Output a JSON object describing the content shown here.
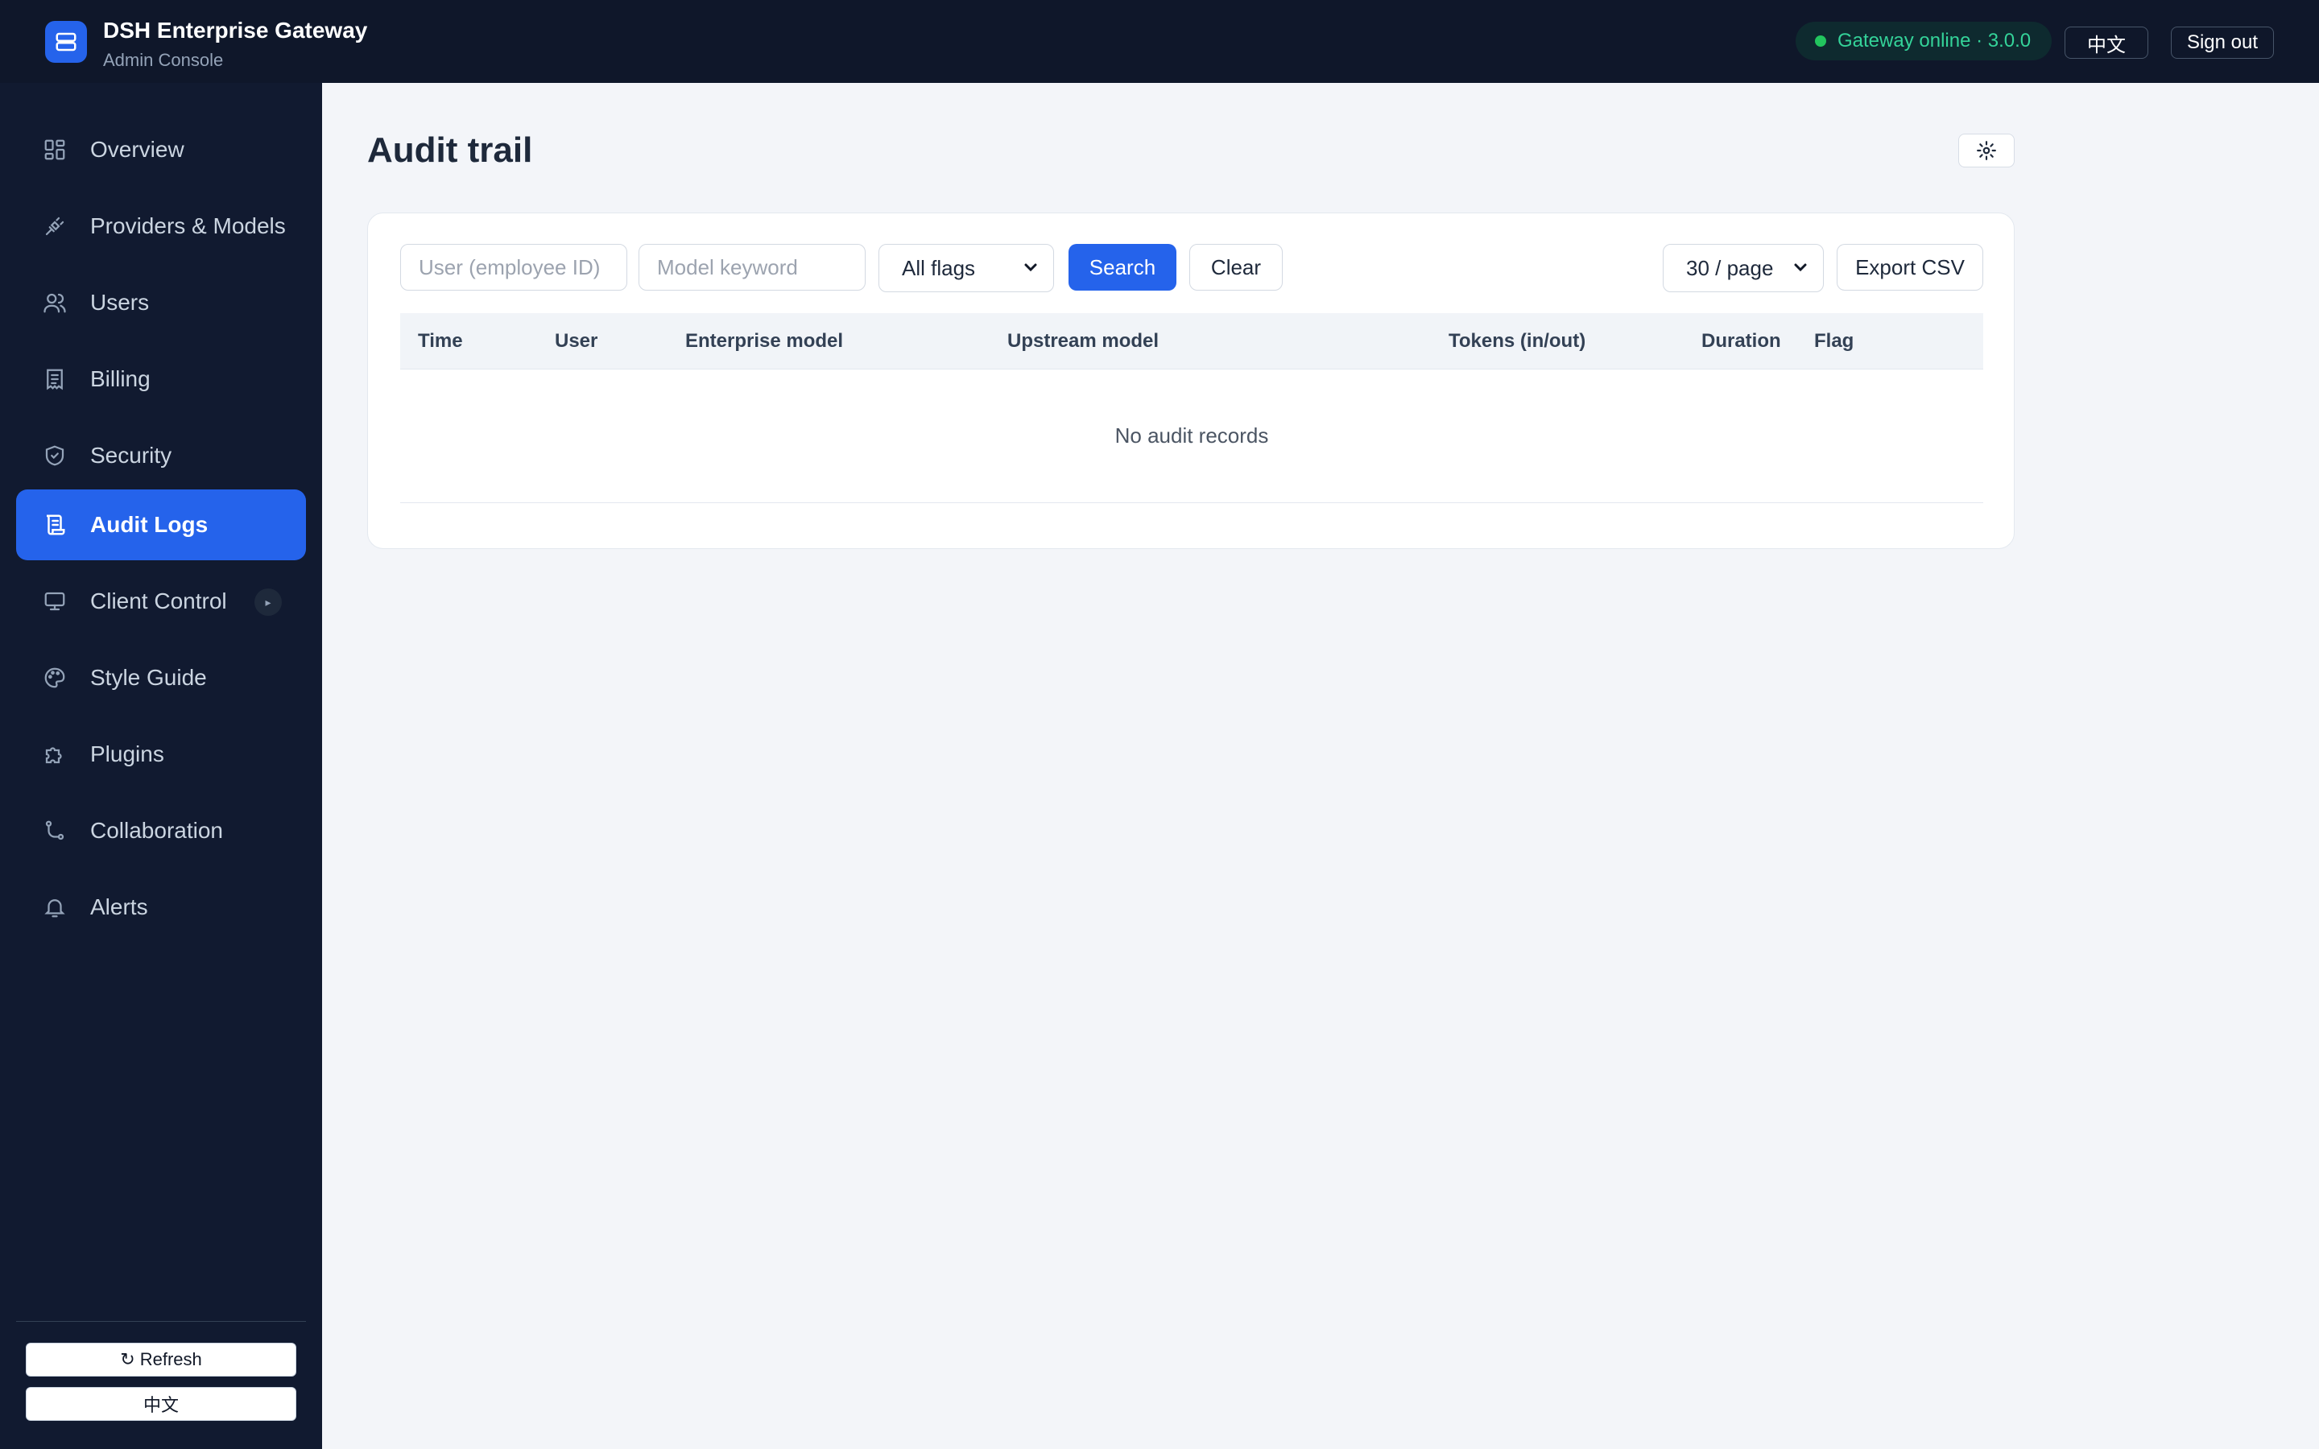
{
  "header": {
    "title": "DSH Enterprise Gateway",
    "subtitle": "Admin Console",
    "status": "Gateway online · 3.0.0",
    "status_color": "#34d399",
    "lang_button": "中文",
    "signout_button": "Sign out"
  },
  "sidebar": {
    "items": [
      {
        "label": "Overview",
        "icon": "grid-icon"
      },
      {
        "label": "Providers & Models",
        "icon": "plug-icon"
      },
      {
        "label": "Users",
        "icon": "users-icon"
      },
      {
        "label": "Billing",
        "icon": "receipt-icon"
      },
      {
        "label": "Security",
        "icon": "shield-icon"
      },
      {
        "label": "Audit Logs",
        "icon": "scroll-icon",
        "active": true
      },
      {
        "label": "Client Control",
        "icon": "monitor-icon",
        "badge": "▸"
      },
      {
        "label": "Style Guide",
        "icon": "palette-icon"
      },
      {
        "label": "Plugins",
        "icon": "puzzle-icon"
      },
      {
        "label": "Collaboration",
        "icon": "git-branch-icon"
      },
      {
        "label": "Alerts",
        "icon": "bell-icon"
      }
    ],
    "refresh_button": "↻ Refresh",
    "lang_button": "中文",
    "accent": "#2563eb"
  },
  "main": {
    "title": "Audit trail",
    "filters": {
      "user_placeholder": "User (employee ID)",
      "model_placeholder": "Model keyword",
      "flags_selected": "All flags",
      "search_button": "Search",
      "clear_button": "Clear",
      "page_size_selected": "30 / page",
      "export_button": "Export CSV"
    },
    "table": {
      "columns": [
        "Time",
        "User",
        "Enterprise model",
        "Upstream model",
        "Tokens (in/out)",
        "Duration",
        "Flag"
      ],
      "rows": [],
      "empty_text": "No audit records"
    }
  }
}
